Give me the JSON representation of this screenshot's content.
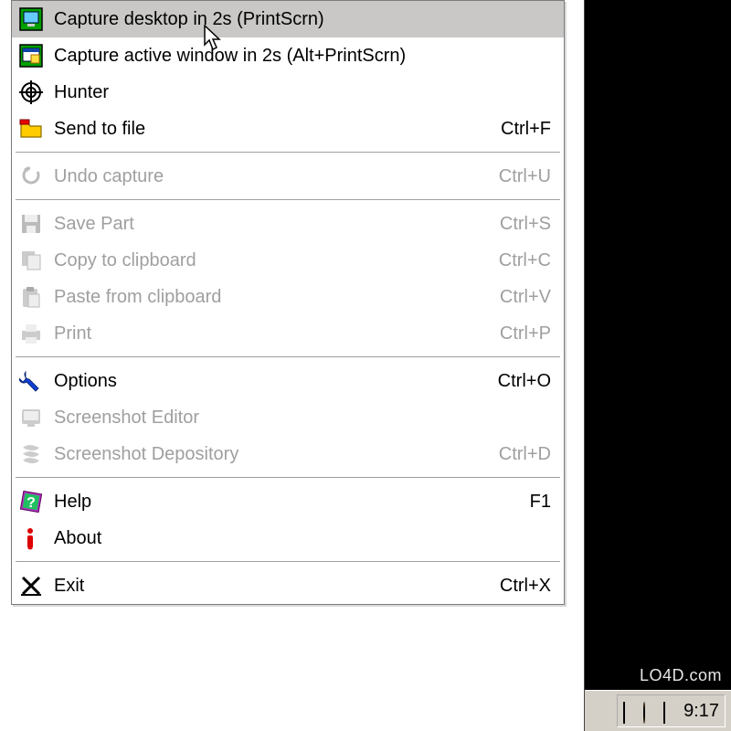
{
  "menu": {
    "items": [
      {
        "label": "Capture desktop in 2s (PrintScrn)",
        "shortcut": "",
        "icon": "capture-desktop-icon",
        "enabled": true,
        "highlight": true
      },
      {
        "label": "Capture active window in 2s (Alt+PrintScrn)",
        "shortcut": "",
        "icon": "capture-window-icon",
        "enabled": true
      },
      {
        "label": "Hunter",
        "shortcut": "",
        "icon": "target-icon",
        "enabled": true
      },
      {
        "label": "Send to file",
        "shortcut": "Ctrl+F",
        "icon": "folder-icon",
        "enabled": true
      },
      {
        "sep": true
      },
      {
        "label": "Undo capture",
        "shortcut": "Ctrl+U",
        "icon": "undo-icon",
        "enabled": false
      },
      {
        "sep": true
      },
      {
        "label": "Save Part",
        "shortcut": "Ctrl+S",
        "icon": "save-icon",
        "enabled": false
      },
      {
        "label": "Copy to clipboard",
        "shortcut": "Ctrl+C",
        "icon": "copy-icon",
        "enabled": false
      },
      {
        "label": "Paste from clipboard",
        "shortcut": "Ctrl+V",
        "icon": "paste-icon",
        "enabled": false
      },
      {
        "label": "Print",
        "shortcut": "Ctrl+P",
        "icon": "print-icon",
        "enabled": false
      },
      {
        "sep": true
      },
      {
        "label": "Options",
        "shortcut": "Ctrl+O",
        "icon": "wrench-icon",
        "enabled": true
      },
      {
        "label": "Screenshot Editor",
        "shortcut": "",
        "icon": "editor-icon",
        "enabled": false
      },
      {
        "label": "Screenshot Depository",
        "shortcut": "Ctrl+D",
        "icon": "depository-icon",
        "enabled": false
      },
      {
        "sep": true
      },
      {
        "label": "Help",
        "shortcut": "F1",
        "icon": "help-icon",
        "enabled": true
      },
      {
        "label": "About",
        "shortcut": "",
        "icon": "info-icon",
        "enabled": true
      },
      {
        "sep": true
      },
      {
        "label": "Exit",
        "shortcut": "Ctrl+X",
        "icon": "exit-icon",
        "enabled": true
      }
    ]
  },
  "taskbar": {
    "clock": "9:17"
  },
  "watermark": "LO4D.com"
}
